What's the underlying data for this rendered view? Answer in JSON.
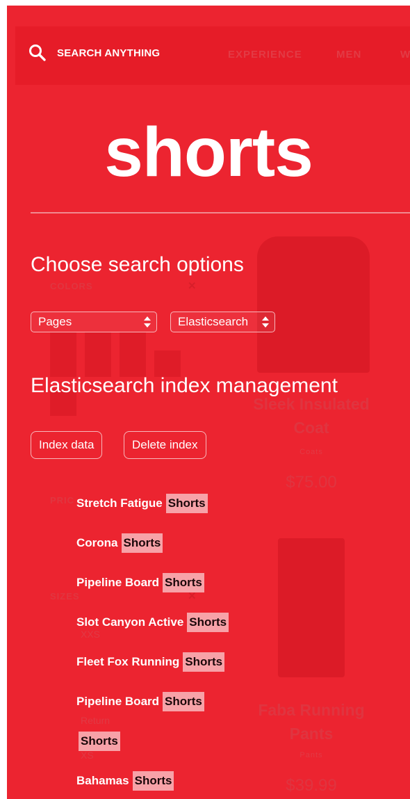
{
  "search": {
    "label": "SEARCH ANYTHING",
    "query": "shorts"
  },
  "background_store": {
    "nav": [
      "EXPERIENCE",
      "MEN",
      "W"
    ],
    "facets": {
      "colors": "COLORS",
      "price": "PRIC",
      "sizes": "SIZES",
      "clear_symbol": "✕",
      "size_values": [
        "XXS",
        "XS"
      ]
    },
    "products": [
      {
        "name_line1": "Sleek Insulated",
        "name_line2": "Coat",
        "sub": "Coats",
        "price": "$75.00"
      },
      {
        "name_line1": "Faba Running",
        "name_line2": "Pants",
        "sub": "Pants",
        "price": "$39.99"
      }
    ],
    "misc": "Return"
  },
  "search_options": {
    "heading": "Choose search options",
    "selects": [
      {
        "value": "Pages"
      },
      {
        "value": "Elasticsearch"
      }
    ]
  },
  "index_management": {
    "heading": "Elasticsearch index management",
    "buttons": [
      {
        "label": "Index data"
      },
      {
        "label": "Delete index"
      }
    ]
  },
  "results": [
    {
      "prefix": "Stretch Fatigue",
      "match": "Shorts"
    },
    {
      "prefix": "Corona",
      "match": "Shorts"
    },
    {
      "prefix": "Pipeline Board",
      "match": "Shorts"
    },
    {
      "prefix": "Slot Canyon Active",
      "match": "Shorts"
    },
    {
      "prefix": "Fleet Fox Running",
      "match": "Shorts"
    },
    {
      "prefix": "Pipeline Board",
      "match": "Shorts"
    },
    {
      "prefix": "",
      "match": "Shorts"
    },
    {
      "prefix": "Bahamas",
      "match": "Shorts"
    }
  ],
  "colors": {
    "overlay_red": "#ec2430",
    "highlight": "#f7a2a8",
    "text": "#ffffff"
  }
}
